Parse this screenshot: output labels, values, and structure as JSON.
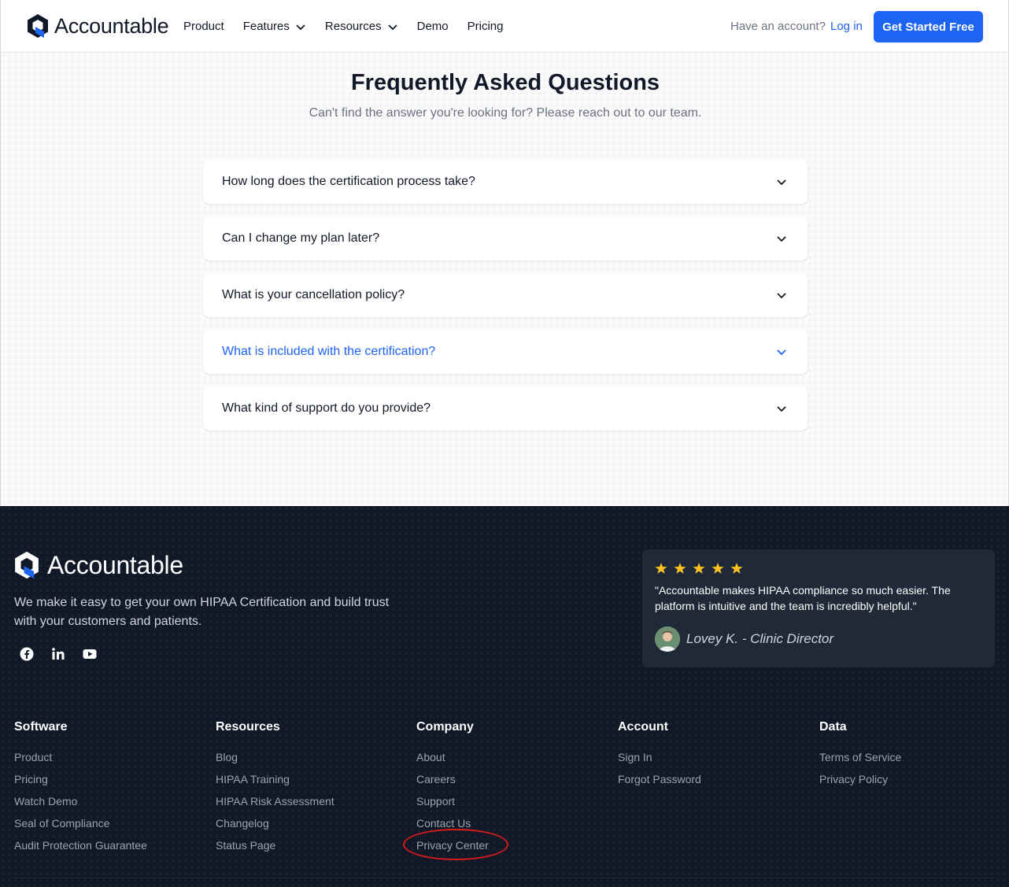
{
  "header": {
    "brand": "Accountable",
    "nav": [
      {
        "label": "Product",
        "dropdown": false
      },
      {
        "label": "Features",
        "dropdown": true
      },
      {
        "label": "Resources",
        "dropdown": true
      },
      {
        "label": "Demo",
        "dropdown": false
      },
      {
        "label": "Pricing",
        "dropdown": false
      }
    ],
    "have_account": "Have an account?",
    "login": "Log in",
    "cta": "Get Started Free"
  },
  "faq": {
    "title": "Frequently Asked Questions",
    "subtitle": "Can't find the answer you're looking for? Please reach out to our team.",
    "items": [
      {
        "question": "How long does the certification process take?",
        "active": false
      },
      {
        "question": "Can I change my plan later?",
        "active": false
      },
      {
        "question": "What is your cancellation policy?",
        "active": false
      },
      {
        "question": "What is included with the certification?",
        "active": true
      },
      {
        "question": "What kind of support do you provide?",
        "active": false
      }
    ]
  },
  "footer": {
    "brand": "Accountable",
    "description": "We make it easy to get your own HIPAA Certification and build trust with your customers and patients.",
    "socials": [
      "facebook-icon",
      "linkedin-icon",
      "youtube-icon"
    ],
    "testimonial": {
      "rating": 5,
      "quote": "\"Accountable makes HIPAA compliance so much easier. The platform is intuitive and the team is incredibly helpful.\"",
      "author": "Lovey K. - Clinic Director"
    },
    "columns": [
      {
        "title": "Software",
        "links": [
          "Product",
          "Pricing",
          "Watch Demo",
          "Seal of Compliance",
          "Audit Protection Guarantee"
        ]
      },
      {
        "title": "Resources",
        "links": [
          "Blog",
          "HIPAA Training",
          "HIPAA Risk Assessment",
          "Changelog",
          "Status Page"
        ]
      },
      {
        "title": "Company",
        "links": [
          "About",
          "Careers",
          "Support",
          "Contact Us",
          "Privacy Center"
        ]
      },
      {
        "title": "Account",
        "links": [
          "Sign In",
          "Forgot Password"
        ]
      },
      {
        "title": "Data",
        "links": [
          "Terms of Service",
          "Privacy Policy"
        ]
      }
    ]
  },
  "colors": {
    "accent": "#1d64f2",
    "footer_bg": "#111827",
    "star": "#fbbf24",
    "highlight": "#d61b1b"
  }
}
